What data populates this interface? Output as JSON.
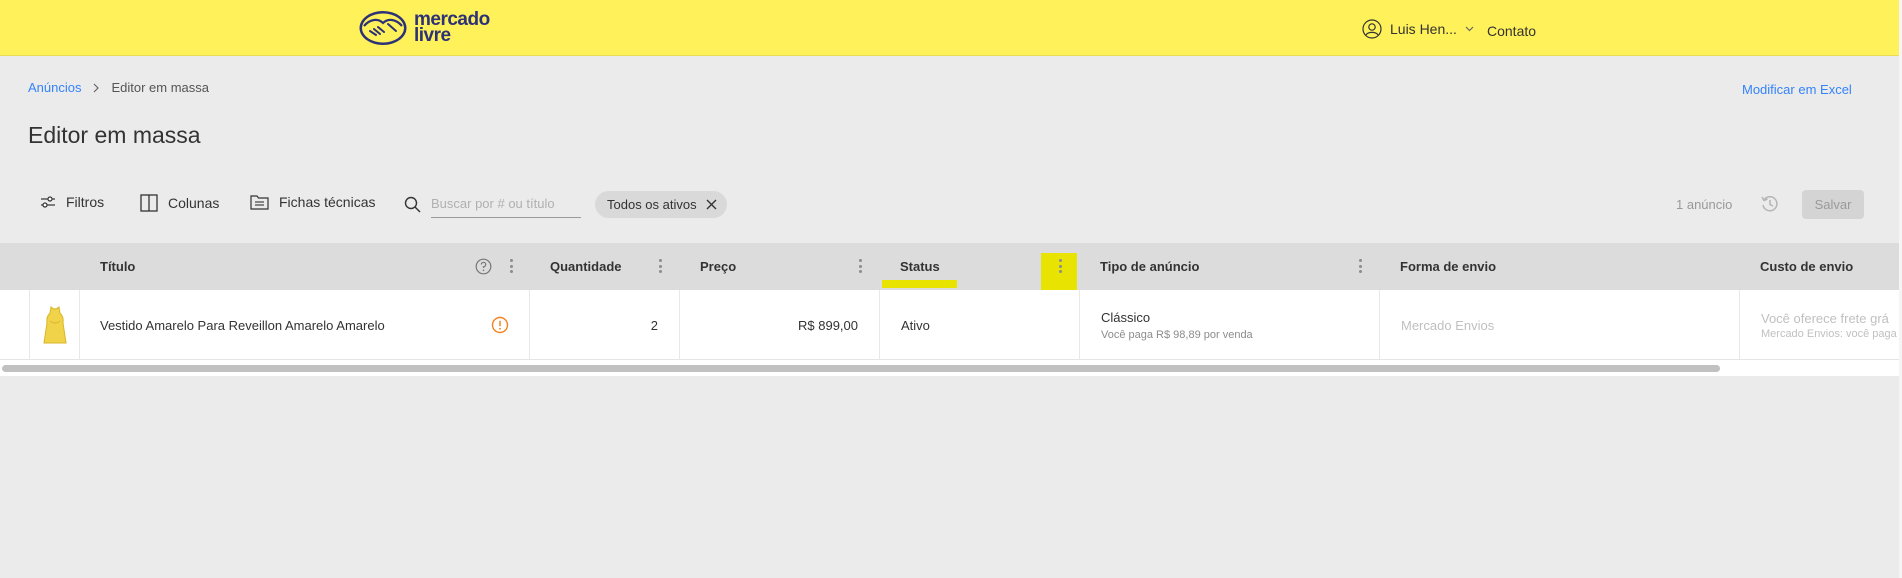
{
  "header": {
    "logo_line1": "mercado",
    "logo_line2": "livre",
    "user_name": "Luis Hen...",
    "contact": "Contato"
  },
  "breadcrumb": {
    "parent": "Anúncios",
    "current": "Editor em massa"
  },
  "excel_link": "Modificar em Excel",
  "page_title": "Editor em massa",
  "toolbar": {
    "filters": "Filtros",
    "columns": "Colunas",
    "sheets": "Fichas técnicas",
    "search_placeholder": "Buscar por # ou título",
    "chip": "Todos os ativos",
    "count": "1 anúncio",
    "save": "Salvar"
  },
  "table": {
    "columns": [
      "Título",
      "Quantidade",
      "Preço",
      "Status",
      "Tipo de anúncio",
      "Forma de envio",
      "Custo de envio"
    ],
    "rows": [
      {
        "title": "Vestido Amarelo Para Reveillon Amarelo Amarelo",
        "quantity": "2",
        "price": "R$ 899,00",
        "status": "Ativo",
        "listing_type": "Clássico",
        "listing_note": "Você paga R$ 98,89 por venda",
        "shipping": "Mercado Envios",
        "shipping_cost": "Você oferece frete grá",
        "shipping_cost_note": "Mercado Envios: você paga"
      }
    ]
  },
  "colors": {
    "header_bg": "#fff159",
    "link": "#3483fa",
    "highlight": "#e8e300",
    "warning": "#f5821f"
  }
}
